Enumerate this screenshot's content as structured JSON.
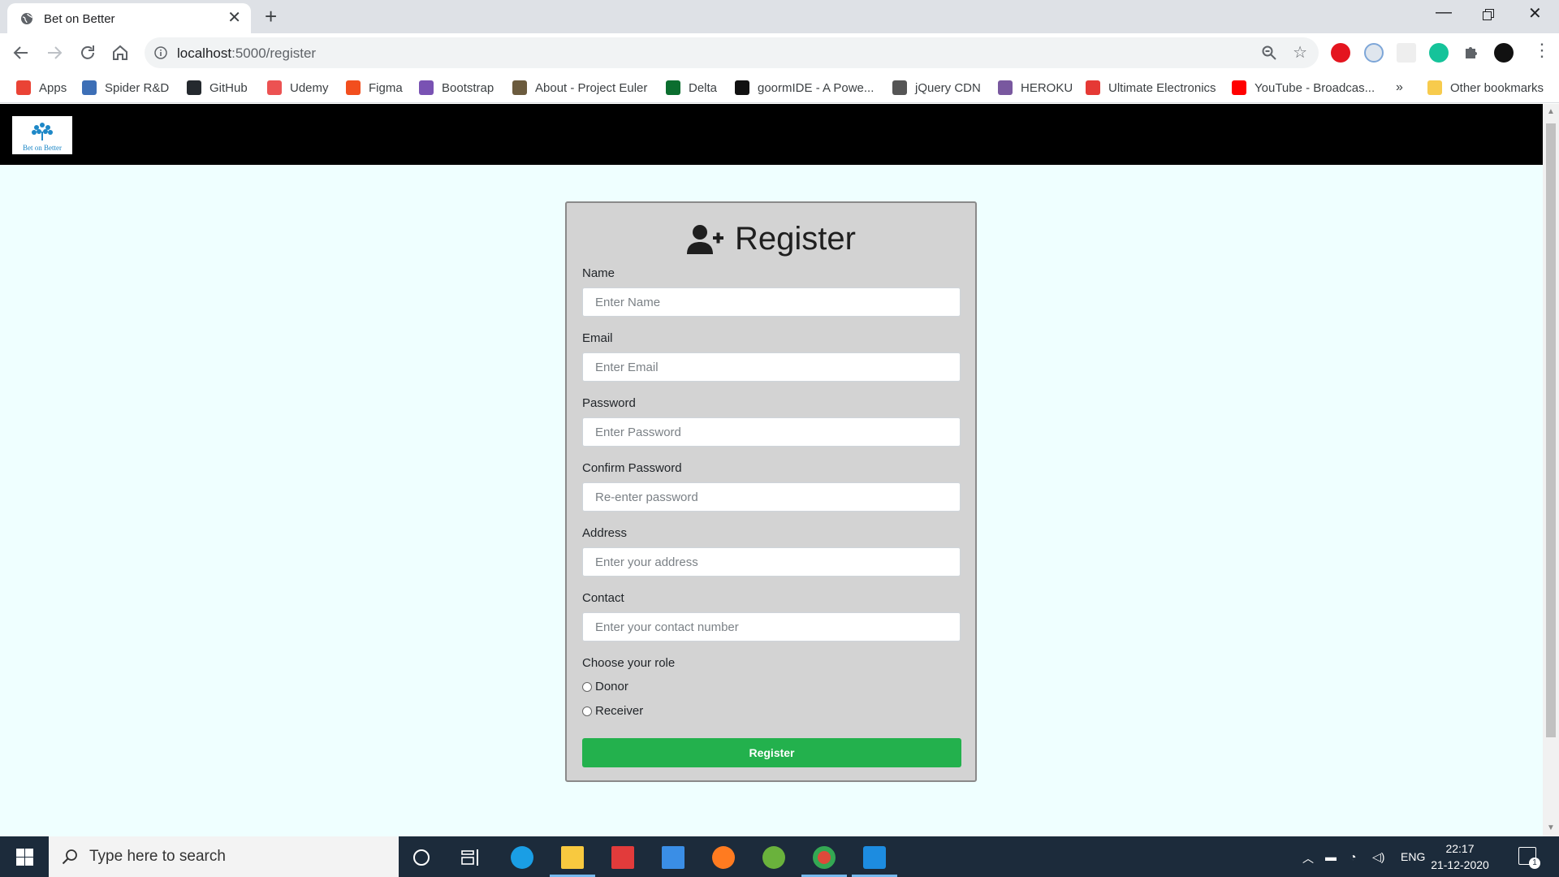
{
  "browser": {
    "tab_title": "Bet on Better",
    "url_host": "localhost",
    "url_path": ":5000/register",
    "bookmarks": [
      {
        "label": "Apps",
        "color": "#ea4335"
      },
      {
        "label": "Spider R&D",
        "color": "#3d6fb6"
      },
      {
        "label": "GitHub",
        "color": "#24292e"
      },
      {
        "label": "Udemy",
        "color": "#ec5252"
      },
      {
        "label": "Figma",
        "color": "#f24e1e"
      },
      {
        "label": "Bootstrap",
        "color": "#7952b3"
      },
      {
        "label": "About - Project Euler",
        "color": "#6b5b3e"
      },
      {
        "label": "Delta",
        "color": "#0b6e2f"
      },
      {
        "label": "goormIDE - A Powe...",
        "color": "#111111"
      },
      {
        "label": "jQuery CDN",
        "color": "#555555"
      },
      {
        "label": "HEROKU",
        "color": "#79589f"
      },
      {
        "label": "Ultimate Electronics",
        "color": "#e53935"
      },
      {
        "label": "YouTube - Broadcas...",
        "color": "#ff0000"
      }
    ],
    "more_bookmarks": "»",
    "other_bookmarks": "Other bookmarks"
  },
  "site": {
    "logo_text": "Bet on Better"
  },
  "form": {
    "title": "Register",
    "name_label": "Name",
    "name_placeholder": "Enter Name",
    "email_label": "Email",
    "email_placeholder": "Enter Email",
    "password_label": "Password",
    "password_placeholder": "Enter Password",
    "confirm_label": "Confirm Password",
    "confirm_placeholder": "Re-enter password",
    "address_label": "Address",
    "address_placeholder": "Enter your address",
    "contact_label": "Contact",
    "contact_placeholder": "Enter your contact number",
    "role_label": "Choose your role",
    "role_options": [
      "Donor",
      "Receiver"
    ],
    "submit_label": "Register",
    "submit_color": "#23b14d"
  },
  "taskbar": {
    "search_placeholder": "Type here to search",
    "language": "ENG",
    "time": "22:17",
    "date": "21-12-2020",
    "notification_count": "1"
  }
}
